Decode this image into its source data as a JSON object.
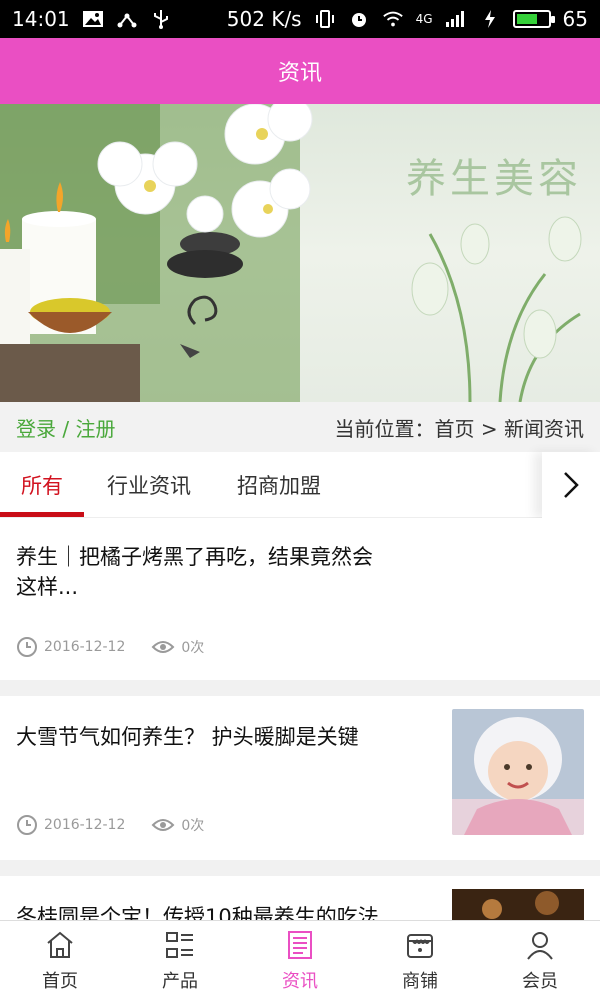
{
  "status_bar": {
    "time": "14:01",
    "network_speed": "502 K/s",
    "signal_type": "4G",
    "battery_level": "65",
    "colors": {
      "battery": "#36d13a"
    }
  },
  "header": {
    "title": "资讯",
    "bg": "#ea4fc3"
  },
  "banner": {
    "title": "养生美容"
  },
  "location_row": {
    "login_label": "登录 / 注册",
    "breadcrumb": "当前位置：首页 > 新闻资讯"
  },
  "tabs": [
    {
      "label": "所有",
      "active": true
    },
    {
      "label": "行业资讯",
      "active": false
    },
    {
      "label": "招商加盟",
      "active": false
    }
  ],
  "articles": [
    {
      "title_line1": "养生｜把橘子烤黑了再吃，结果竟然会",
      "title_line2": "这样...",
      "date": "2016-12-12",
      "views": "0次",
      "has_image": false
    },
    {
      "title_line1": "大雪节气如何养生？ 护头暖脚是关键",
      "date": "2016-12-12",
      "views": "0次",
      "has_image": true
    },
    {
      "title_line1": "冬桂圆是个宝！传授10种最养生的吃法",
      "has_image": true
    }
  ],
  "bottom_nav": [
    {
      "label": "首页",
      "icon": "home-icon",
      "active": false
    },
    {
      "label": "产品",
      "icon": "product-grid-icon",
      "active": false
    },
    {
      "label": "资讯",
      "icon": "news-icon",
      "active": true
    },
    {
      "label": "商铺",
      "icon": "store-icon",
      "active": false
    },
    {
      "label": "会员",
      "icon": "member-icon",
      "active": false
    }
  ],
  "colors": {
    "accent": "#ea4fc3",
    "tab_active": "#c90d17",
    "login_green": "#4aa83b"
  }
}
